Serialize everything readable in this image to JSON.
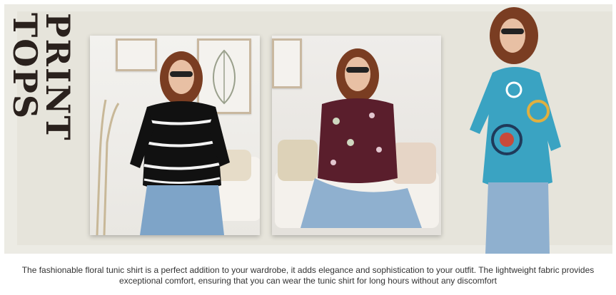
{
  "banner": {
    "title": "PRINT TOPS",
    "products": [
      {
        "name": "black-stripe-top"
      },
      {
        "name": "burgundy-floral-top"
      },
      {
        "name": "teal-mandala-top"
      }
    ]
  },
  "description": "The fashionable floral tunic shirt is a perfect addition to your wardrobe, it adds elegance and sophistication to your outfit. The lightweight fabric provides exceptional comfort, ensuring that you can wear the tunic shirt for long hours without any discomfort",
  "colors": {
    "background": "#ecebe4",
    "title": "#2a211d",
    "stripe_top": "#111111",
    "burgundy_top": "#5a1e2c",
    "teal_top": "#3aa3c2",
    "jeans": "#8fb0cf"
  }
}
